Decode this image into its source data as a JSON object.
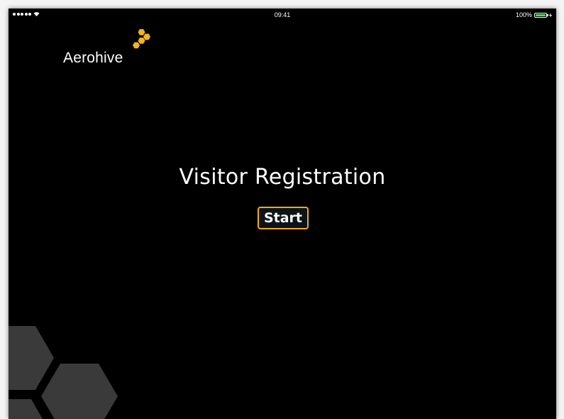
{
  "status_bar": {
    "time": "09:41",
    "battery_percent": "100%",
    "signal_icon": "signal-dots-icon",
    "wifi_icon": "wifi-icon",
    "battery_icon": "battery-icon",
    "charging_icon": "charging-icon"
  },
  "logo": {
    "text": "Aerohive",
    "mark_icon": "honeycomb-logo-icon",
    "mark_color": "#f3b31b"
  },
  "main": {
    "title": "Visitor Registration",
    "start_label": "Start"
  },
  "colors": {
    "background": "#000000",
    "accent": "#f3a823",
    "hex_decoration": "#3a3a3a"
  }
}
